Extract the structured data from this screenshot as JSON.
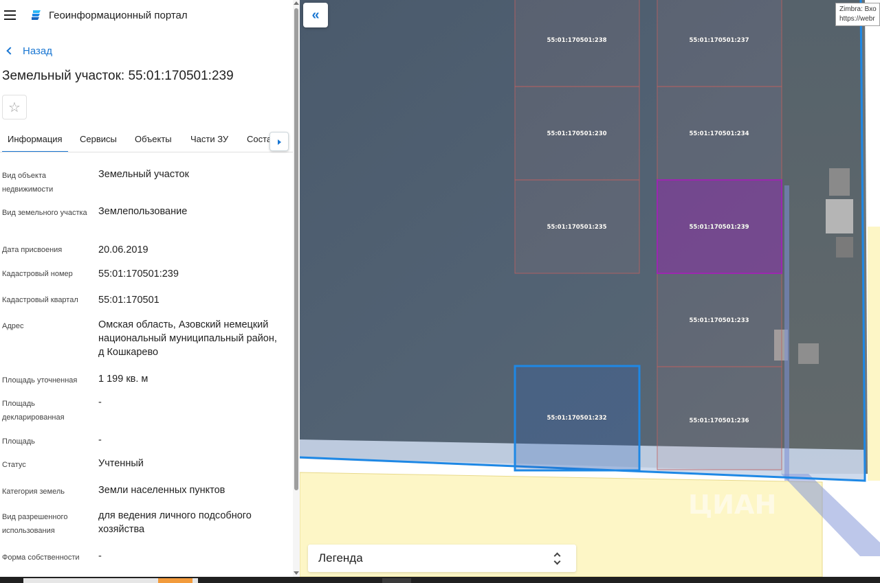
{
  "app": {
    "title": "Геоинформационный портал",
    "back_label": "Назад",
    "page_title": "Земельный участок: 55:01:170501:239"
  },
  "tabs": [
    {
      "label": "Информация",
      "active": true
    },
    {
      "label": "Сервисы",
      "active": false
    },
    {
      "label": "Объекты",
      "active": false
    },
    {
      "label": "Части ЗУ",
      "active": false
    },
    {
      "label": "Соста",
      "active": false
    }
  ],
  "properties": [
    {
      "label": "Вид объекта недвижимости",
      "value": "Земельный участок"
    },
    {
      "label": "Вид земельного участка",
      "value": "Землепользование"
    },
    {
      "label": "Дата присвоения",
      "value": "20.06.2019"
    },
    {
      "label": "Кадастровый номер",
      "value": "55:01:170501:239"
    },
    {
      "label": "Кадастровый квартал",
      "value": "55:01:170501"
    },
    {
      "label": "Адрес",
      "value": "Омская область, Азовский немецкий национальный муниципальный район, д Кошкарево"
    },
    {
      "label": "Площадь уточненная",
      "value": "1 199 кв. м"
    },
    {
      "label": "Площадь декларированная",
      "value": "-"
    },
    {
      "label": "Площадь",
      "value": "-"
    },
    {
      "label": "Статус",
      "value": "Учтенный"
    },
    {
      "label": "Категория земель",
      "value": "Земли населенных пунктов"
    },
    {
      "label": "Вид разрешенного использования",
      "value": "для ведения личного подсобного хозяйства"
    },
    {
      "label": "Форма собственности",
      "value": "-"
    }
  ],
  "map": {
    "parcels": [
      {
        "id": "55:01:170501:238",
        "state": "normal"
      },
      {
        "id": "55:01:170501:237",
        "state": "normal"
      },
      {
        "id": "55:01:170501:230",
        "state": "normal"
      },
      {
        "id": "55:01:170501:234",
        "state": "normal"
      },
      {
        "id": "55:01:170501:235",
        "state": "normal"
      },
      {
        "id": "55:01:170501:239",
        "state": "selected"
      },
      {
        "id": "55:01:170501:233",
        "state": "normal"
      },
      {
        "id": "55:01:170501:232",
        "state": "highlighted"
      },
      {
        "id": "55:01:170501:236",
        "state": "normal"
      }
    ],
    "collapse_icon": "double-chevron-left-icon",
    "tooltip_line1": "Zimbra: Вхо",
    "tooltip_line2": "https://webr",
    "legend_label": "Легенда",
    "watermark": "ЦИАН"
  },
  "colors": {
    "accent": "#1976d2",
    "selected_parcel": "#9c27b0",
    "highlight_border": "#1e88e5",
    "parcel_border": "#c06060",
    "zone_fill": "#fdf6c6"
  }
}
